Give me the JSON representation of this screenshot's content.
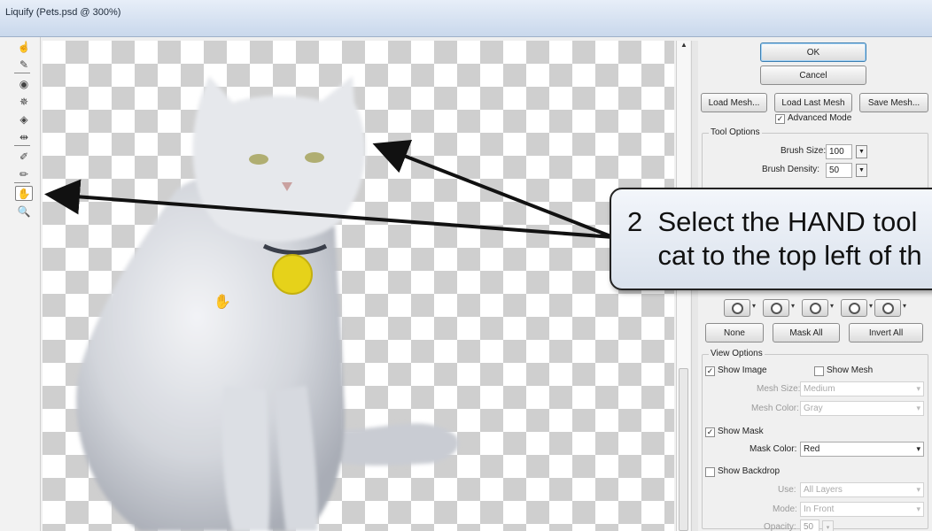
{
  "window": {
    "title": "Liquify (Pets.psd @ 300%)"
  },
  "toolbar": {
    "tools": [
      {
        "name": "forward-warp-tool-icon",
        "glyph": "☝"
      },
      {
        "name": "reconstruct-tool-icon",
        "glyph": "✎"
      },
      {
        "name": "twirl-tool-icon",
        "glyph": "◉"
      },
      {
        "name": "pucker-tool-icon",
        "glyph": "✵"
      },
      {
        "name": "bloat-tool-icon",
        "glyph": "◈"
      },
      {
        "name": "push-left-tool-icon",
        "glyph": "⇹"
      },
      {
        "name": "freeze-mask-tool-icon",
        "glyph": "✐"
      },
      {
        "name": "thaw-mask-tool-icon",
        "glyph": "✏"
      },
      {
        "name": "hand-tool-icon",
        "glyph": "✋"
      },
      {
        "name": "zoom-tool-icon",
        "glyph": "🔍"
      }
    ]
  },
  "panel": {
    "ok_label": "OK",
    "cancel_label": "Cancel",
    "load_mesh_label": "Load Mesh...",
    "load_last_mesh_label": "Load Last Mesh",
    "save_mesh_label": "Save Mesh...",
    "advanced_mode_label": "Advanced Mode",
    "advanced_mode_checked": "✓",
    "tool_options_title": "Tool Options",
    "brush_size_label": "Brush Size:",
    "brush_size_value": "100",
    "brush_density_label": "Brush Density:",
    "brush_density_value": "50",
    "mask_none_label": "None",
    "mask_all_label": "Mask All",
    "invert_all_label": "Invert All",
    "view_options_title": "View Options",
    "show_image_label": "Show Image",
    "show_image_checked": "✓",
    "show_mesh_label": "Show Mesh",
    "mesh_size_label": "Mesh Size:",
    "mesh_size_value": "Medium",
    "mesh_color_label": "Mesh Color:",
    "mesh_color_value": "Gray",
    "show_mask_label": "Show Mask",
    "show_mask_checked": "✓",
    "mask_color_label": "Mask Color:",
    "mask_color_value": "Red",
    "show_backdrop_label": "Show Backdrop",
    "use_label": "Use:",
    "use_value": "All Layers",
    "mode_label": "Mode:",
    "mode_value": "In Front",
    "opacity_label": "Opacity:",
    "opacity_value": "50"
  },
  "callout": {
    "text": "2  Select the HAND tool\n    cat to the top left of th"
  },
  "colors": {
    "tag": "#e6d21a",
    "arrow": "#111111",
    "cat": "#d9dbe0"
  }
}
